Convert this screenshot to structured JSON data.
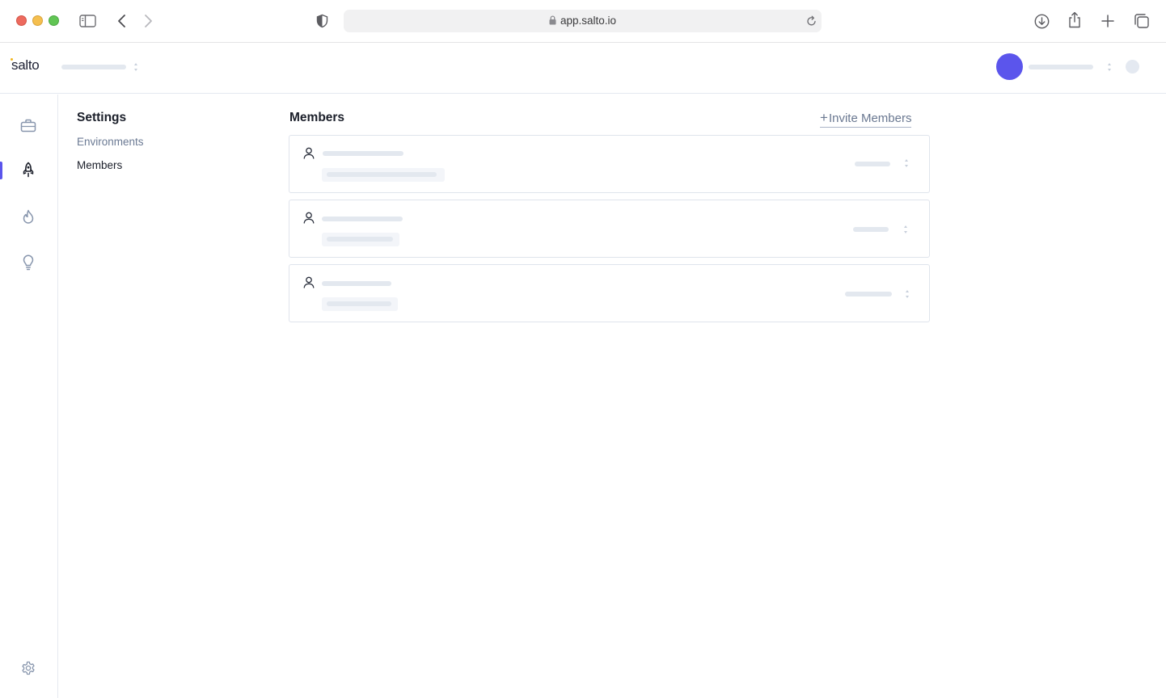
{
  "browser": {
    "url": "app.salto.io",
    "icons": [
      "sidebar-toggle-icon",
      "back-icon",
      "forward-icon",
      "shield-icon",
      "lock-icon",
      "reload-icon",
      "download-icon",
      "share-icon",
      "new-tab-icon",
      "tabs-overview-icon"
    ]
  },
  "header": {
    "logo_text": "salto",
    "accent_color": "#5b55ec",
    "logo_dot_color": "#f2b51b"
  },
  "rail": {
    "items": [
      {
        "icon": "briefcase-icon",
        "active": false
      },
      {
        "icon": "rocket-icon",
        "active": true
      },
      {
        "icon": "flame-icon",
        "active": false
      },
      {
        "icon": "lightbulb-icon",
        "active": false
      }
    ],
    "footer_icon": "gear-icon"
  },
  "settings": {
    "title": "Settings",
    "nav": [
      {
        "label": "Environments",
        "active": false
      },
      {
        "label": "Members",
        "active": true
      }
    ]
  },
  "members": {
    "title": "Members",
    "invite_label": "Invite Members",
    "invite_icon": "plus-icon",
    "rows": [
      {
        "icon": "person-icon",
        "loading": true
      },
      {
        "icon": "person-icon",
        "loading": true
      },
      {
        "icon": "person-icon",
        "loading": true
      }
    ]
  }
}
